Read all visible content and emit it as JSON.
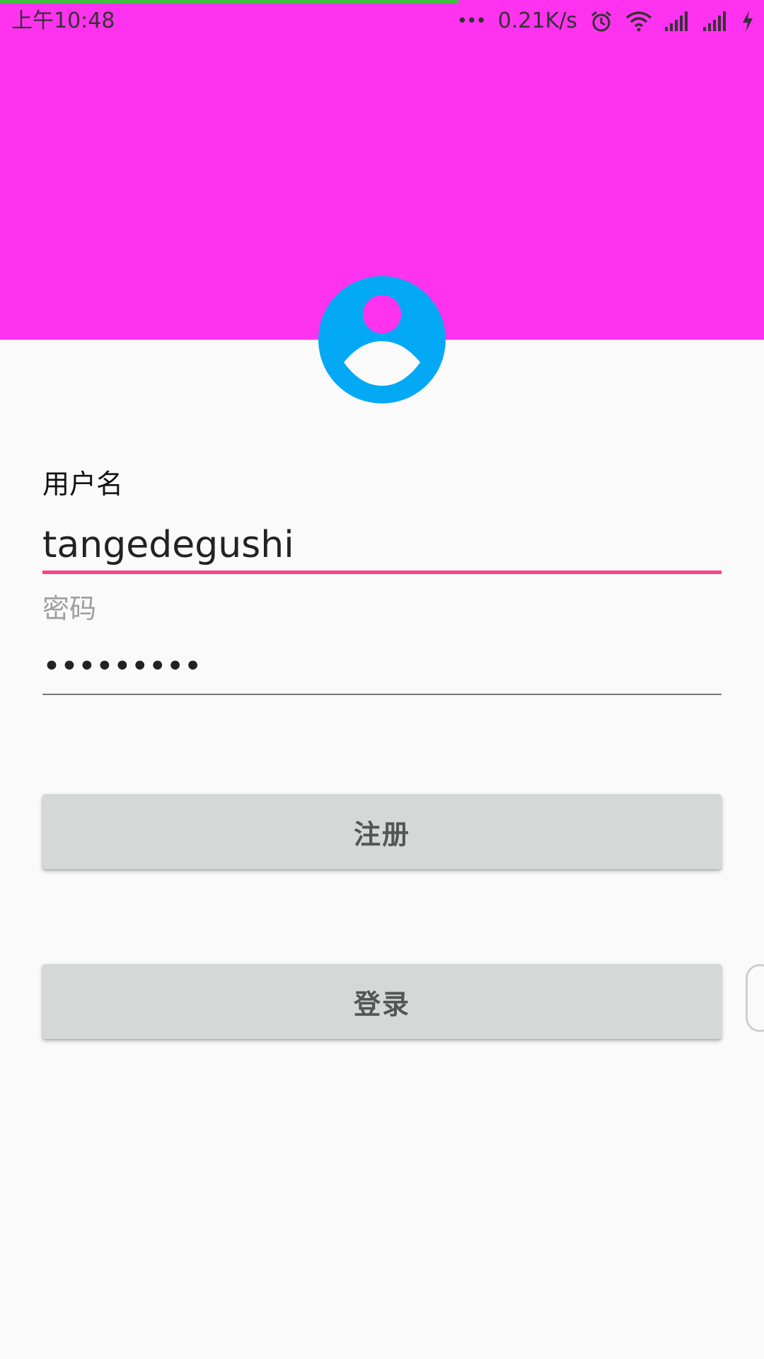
{
  "colors": {
    "header_bg": "#ff33ef",
    "avatar_bg": "#03a9f4",
    "avatar_head": "#ff33ef",
    "avatar_body": "#fafafa",
    "progress": "#3fbf3f",
    "accent_underline": "#ff4081",
    "inactive_underline": "#777777"
  },
  "status_bar": {
    "time": "上午10:48",
    "more": "•••",
    "speed": "0.21K/s",
    "icons": [
      "alarm-icon",
      "wifi-icon",
      "signal-icon",
      "signal-icon",
      "charging-icon"
    ]
  },
  "load_progress": 0.6,
  "form": {
    "username_label": "用户名",
    "username_value": "tangedegushi",
    "password_label": "密码",
    "password_value": "•••••••••"
  },
  "buttons": {
    "register_label": "注册",
    "login_label": "登录"
  }
}
